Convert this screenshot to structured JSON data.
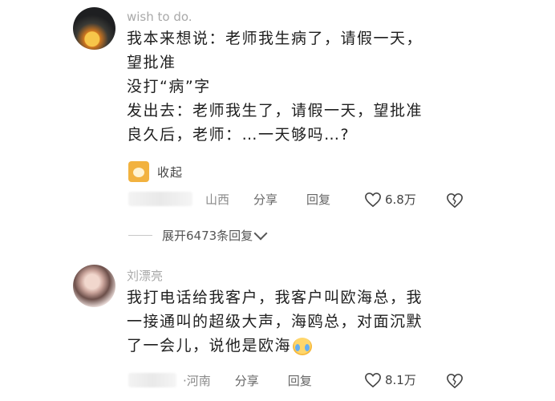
{
  "comments": [
    {
      "username": "wish to do.",
      "lines": [
        "我本来想说：老师我生病了，请假一天，",
        "望批准",
        "没打“病”字",
        "发出去：老师我生了，请假一天，望批准",
        "良久后，老师：…一天够吗…?"
      ],
      "collapse_label": "收起",
      "location": "山西",
      "share_label": "分享",
      "reply_label": "回复",
      "likes": "6.8万"
    },
    {
      "username": "刘漂亮",
      "lines": [
        "我打电话给我客户，我客户叫欧海总，我",
        "一接通叫的超级大声，海鸥总，对面沉默",
        "了一会儿，说他是欧海"
      ],
      "location": "·河南",
      "share_label": "分享",
      "reply_label": "回复",
      "likes": "8.1万"
    }
  ],
  "expand_replies_label": "展开6473条回复",
  "icons": {
    "avatar1": "avatar",
    "avatar2": "avatar",
    "collapse": "cat-sticker-icon",
    "like": "heart-icon",
    "dislike": "broken-heart-icon",
    "expand": "chevron-down-icon",
    "emoji": "crying-face-emoji"
  },
  "colors": {
    "username": "#a9a9a9",
    "body_text": "#1f1f1f",
    "meta_text": "#666666"
  }
}
